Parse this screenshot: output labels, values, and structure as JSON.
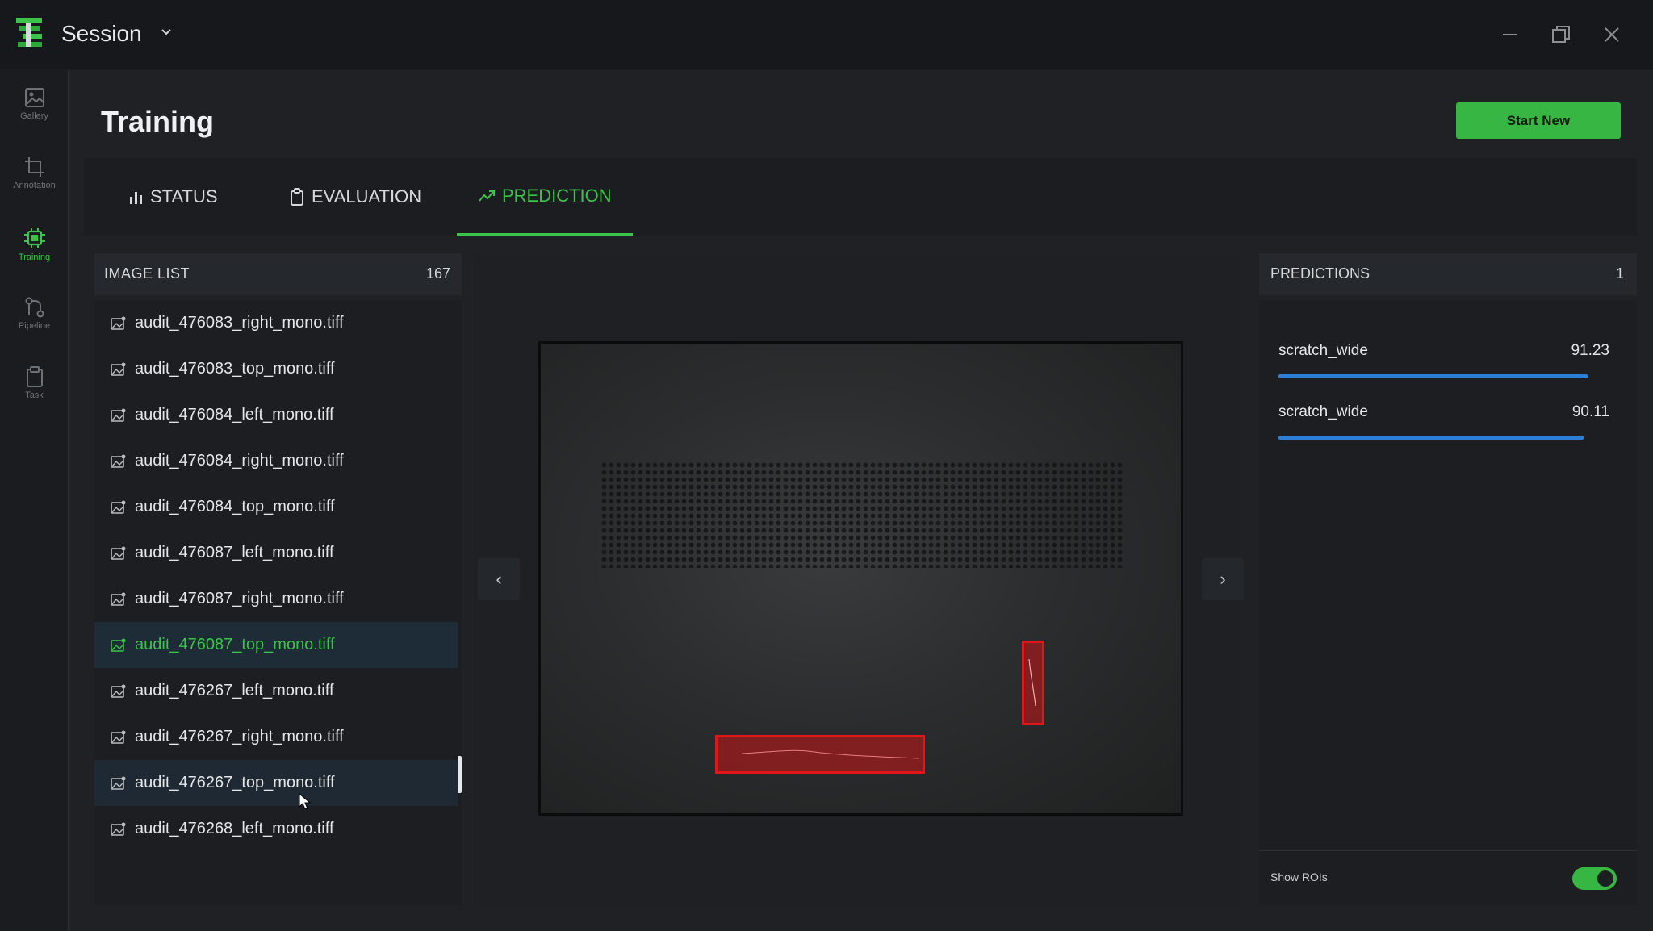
{
  "titlebar": {
    "app_title": "Session"
  },
  "sidebar": {
    "items": [
      {
        "label": "Gallery",
        "icon": "image-icon"
      },
      {
        "label": "Annotation",
        "icon": "crop-icon"
      },
      {
        "label": "Training",
        "icon": "chip-icon",
        "active": true
      },
      {
        "label": "Pipeline",
        "icon": "pipeline-icon"
      },
      {
        "label": "Task",
        "icon": "clipboard-icon"
      }
    ]
  },
  "page": {
    "title": "Training",
    "start_button": "Start New"
  },
  "tabs": [
    {
      "label": "STATUS",
      "icon": "bar-chart-icon"
    },
    {
      "label": "EVALUATION",
      "icon": "clipboard-icon"
    },
    {
      "label": "PREDICTION",
      "icon": "trend-icon",
      "active": true
    }
  ],
  "image_list": {
    "title": "IMAGE LIST",
    "count": "167",
    "items": [
      "audit_476083_right_mono.tiff",
      "audit_476083_top_mono.tiff",
      "audit_476084_left_mono.tiff",
      "audit_476084_right_mono.tiff",
      "audit_476084_top_mono.tiff",
      "audit_476087_left_mono.tiff",
      "audit_476087_right_mono.tiff",
      "audit_476087_top_mono.tiff",
      "audit_476267_left_mono.tiff",
      "audit_476267_right_mono.tiff",
      "audit_476267_top_mono.tiff",
      "audit_476268_left_mono.tiff"
    ],
    "selected_index": 7,
    "hover_index": 10
  },
  "viewer": {
    "prev_label": "‹",
    "next_label": "›"
  },
  "predictions": {
    "title": "PREDICTIONS",
    "count": "1",
    "items": [
      {
        "label": "scratch_wide",
        "score": "91.23",
        "fraction": 0.9123
      },
      {
        "label": "scratch_wide",
        "score": "90.11",
        "fraction": 0.9011
      }
    ],
    "show_rois_label": "Show ROIs",
    "show_rois": true
  },
  "colors": {
    "accent": "#3cc34a",
    "roi": "#e0161a",
    "bar": "#2c7fd6"
  }
}
